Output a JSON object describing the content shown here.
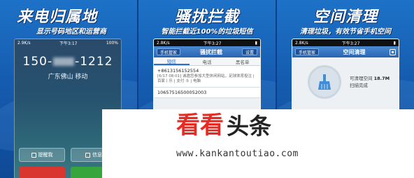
{
  "panels": [
    {
      "headline": "来电归属地",
      "subline": "显示号码地区和运营商",
      "status": {
        "carrier": "2.9K/s",
        "time": "下午3:17",
        "battery": "100%"
      },
      "lock": {
        "number_prefix": "150-",
        "number_suffix": "-1212",
        "location": "广东佛山 移动",
        "actions": [
          "提醒我",
          "信息"
        ]
      }
    },
    {
      "headline": "骚扰拦截",
      "subline": "智能拦截近100%的垃圾短信",
      "status": {
        "carrier": "2.8K/s",
        "time": "下午3:27",
        "battery": ""
      },
      "nav": {
        "back": "手机管家",
        "title": "骚扰拦截",
        "right": "设置"
      },
      "tabs": [
        "短信",
        "电话",
        "黑名单"
      ],
      "messages": [
        {
          "number": "+8613156152554",
          "body": "[6/17 08:01] 诚邀您参加大型休闲网站，足球体育投注 | 百家丨乐 | 支付 斗 | 电脑"
        },
        {
          "number": "10657516500052003",
          "body": ""
        }
      ]
    },
    {
      "headline": "空间清理",
      "subline": "清理垃圾，有效节省手机空间",
      "status": {
        "carrier": "2.8K/s",
        "time": "下午3:27",
        "battery": ""
      },
      "nav": {
        "back": "手机管家",
        "title": "空间清理"
      },
      "clean": {
        "label": "可清理空间",
        "size": "18.7M",
        "status": "扫描完成"
      }
    }
  ],
  "watermark": {
    "logo_red": "看看",
    "logo_dark": "头条",
    "url": "www.kankantoutiao.com"
  }
}
